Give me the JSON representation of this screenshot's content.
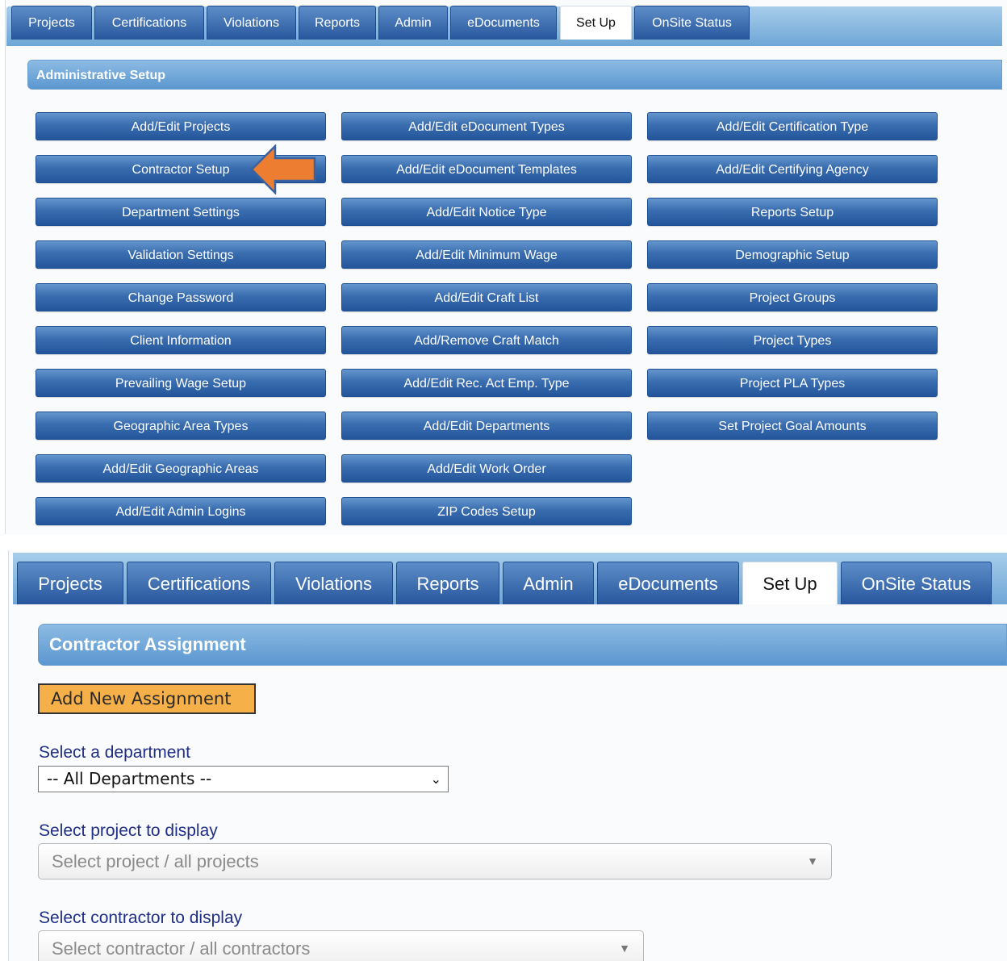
{
  "tabs": [
    "Projects",
    "Certifications",
    "Violations",
    "Reports",
    "Admin",
    "eDocuments",
    "Set Up",
    "OnSite Status"
  ],
  "active_tab": "Set Up",
  "admin_setup": {
    "title": "Administrative Setup",
    "columns": [
      [
        "Add/Edit Projects",
        "Contractor Setup",
        "Department Settings",
        "Validation Settings",
        "Change Password",
        "Client Information",
        "Prevailing Wage Setup",
        "Geographic Area Types",
        "Add/Edit Geographic Areas",
        "Add/Edit Admin Logins"
      ],
      [
        "Add/Edit eDocument Types",
        "Add/Edit eDocument Templates",
        "Add/Edit Notice Type",
        "Add/Edit Minimum Wage",
        "Add/Edit Craft List",
        "Add/Remove Craft Match",
        "Add/Edit Rec. Act Emp. Type",
        "Add/Edit Departments",
        "Add/Edit Work Order",
        "ZIP Codes Setup"
      ],
      [
        "Add/Edit Certification Type",
        "Add/Edit Certifying Agency",
        "Reports Setup",
        "Demographic Setup",
        "Project Groups",
        "Project Types",
        "Project PLA Types",
        "Set Project Goal Amounts"
      ]
    ],
    "highlight_color": "#ed7d31"
  },
  "contractor_assignment": {
    "title": "Contractor Assignment",
    "add_button": "Add New Assignment",
    "department_label": "Select a department",
    "department_value": "-- All Departments --",
    "project_label": "Select project to display",
    "project_placeholder": "Select project / all projects",
    "contractor_label": "Select contractor to display",
    "contractor_placeholder": "Select contractor / all contractors"
  }
}
